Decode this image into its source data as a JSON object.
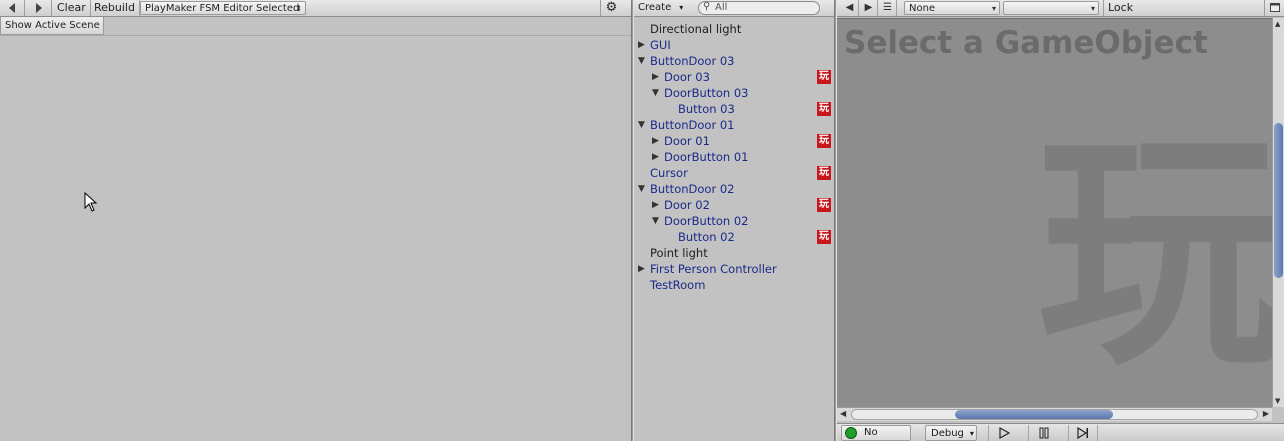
{
  "left_panel": {
    "toolbar": {
      "back_icon": "triangle-left-icon",
      "forward_icon": "triangle-right-icon",
      "clear_label": "Clear",
      "rebuild_label": "Rebuild",
      "fsm_select_value": "PlayMaker FSM Editor Selected",
      "settings_icon": "gear-icon"
    },
    "show_active_label": "Show Active Scene"
  },
  "hierarchy": {
    "create_label": "Create",
    "search_placeholder": "All",
    "items": [
      {
        "label": "Directional light",
        "depth": 0,
        "expander": "none",
        "style": "dark",
        "badge": false
      },
      {
        "label": "GUI",
        "depth": 0,
        "expander": "collapsed",
        "style": "prefab",
        "badge": false
      },
      {
        "label": "ButtonDoor 03",
        "depth": 0,
        "expander": "expanded",
        "style": "prefab",
        "badge": false
      },
      {
        "label": "Door 03",
        "depth": 1,
        "expander": "collapsed",
        "style": "prefab",
        "badge": true
      },
      {
        "label": "DoorButton 03",
        "depth": 1,
        "expander": "expanded",
        "style": "prefab",
        "badge": false
      },
      {
        "label": "Button 03",
        "depth": 2,
        "expander": "none",
        "style": "prefab",
        "badge": true
      },
      {
        "label": "ButtonDoor 01",
        "depth": 0,
        "expander": "expanded",
        "style": "prefab",
        "badge": false
      },
      {
        "label": "Door 01",
        "depth": 1,
        "expander": "collapsed",
        "style": "prefab",
        "badge": true
      },
      {
        "label": "DoorButton 01",
        "depth": 1,
        "expander": "collapsed",
        "style": "prefab",
        "badge": false
      },
      {
        "label": "Cursor",
        "depth": 0,
        "expander": "none",
        "style": "prefab",
        "badge": true
      },
      {
        "label": "ButtonDoor 02",
        "depth": 0,
        "expander": "expanded",
        "style": "prefab",
        "badge": false
      },
      {
        "label": "Door 02",
        "depth": 1,
        "expander": "collapsed",
        "style": "prefab",
        "badge": true
      },
      {
        "label": "DoorButton 02",
        "depth": 1,
        "expander": "expanded",
        "style": "prefab",
        "badge": false
      },
      {
        "label": "Button 02",
        "depth": 2,
        "expander": "none",
        "style": "prefab",
        "badge": true
      },
      {
        "label": "Point light",
        "depth": 0,
        "expander": "none",
        "style": "dark",
        "badge": false
      },
      {
        "label": "First Person Controller",
        "depth": 0,
        "expander": "collapsed",
        "style": "prefab",
        "badge": false
      },
      {
        "label": "TestRoom",
        "depth": 0,
        "expander": "none",
        "style": "prefab",
        "badge": false
      }
    ],
    "badge_glyph": "玩"
  },
  "fsm_view": {
    "toolbar": {
      "prev_icon": "triangle-left-icon",
      "next_icon": "triangle-right-icon",
      "menu_icon": "list-icon",
      "select1_value": "None",
      "select2_value": "",
      "lock_label": "Lock",
      "maximize_icon": "maximize-icon"
    },
    "title": "Select a GameObject",
    "background_glyph": "玩",
    "bottom_bar": {
      "status_label": "No errors",
      "debug_label": "Debug",
      "play_icon": "play-icon",
      "pause_icon": "pause-icon",
      "step_icon": "step-icon"
    }
  },
  "colors": {
    "prefab_text": "#1a2a8a",
    "badge_bg": "#c8161a",
    "viewport_bg": "#8d8d8d",
    "status_ok": "#1e9e2a"
  }
}
